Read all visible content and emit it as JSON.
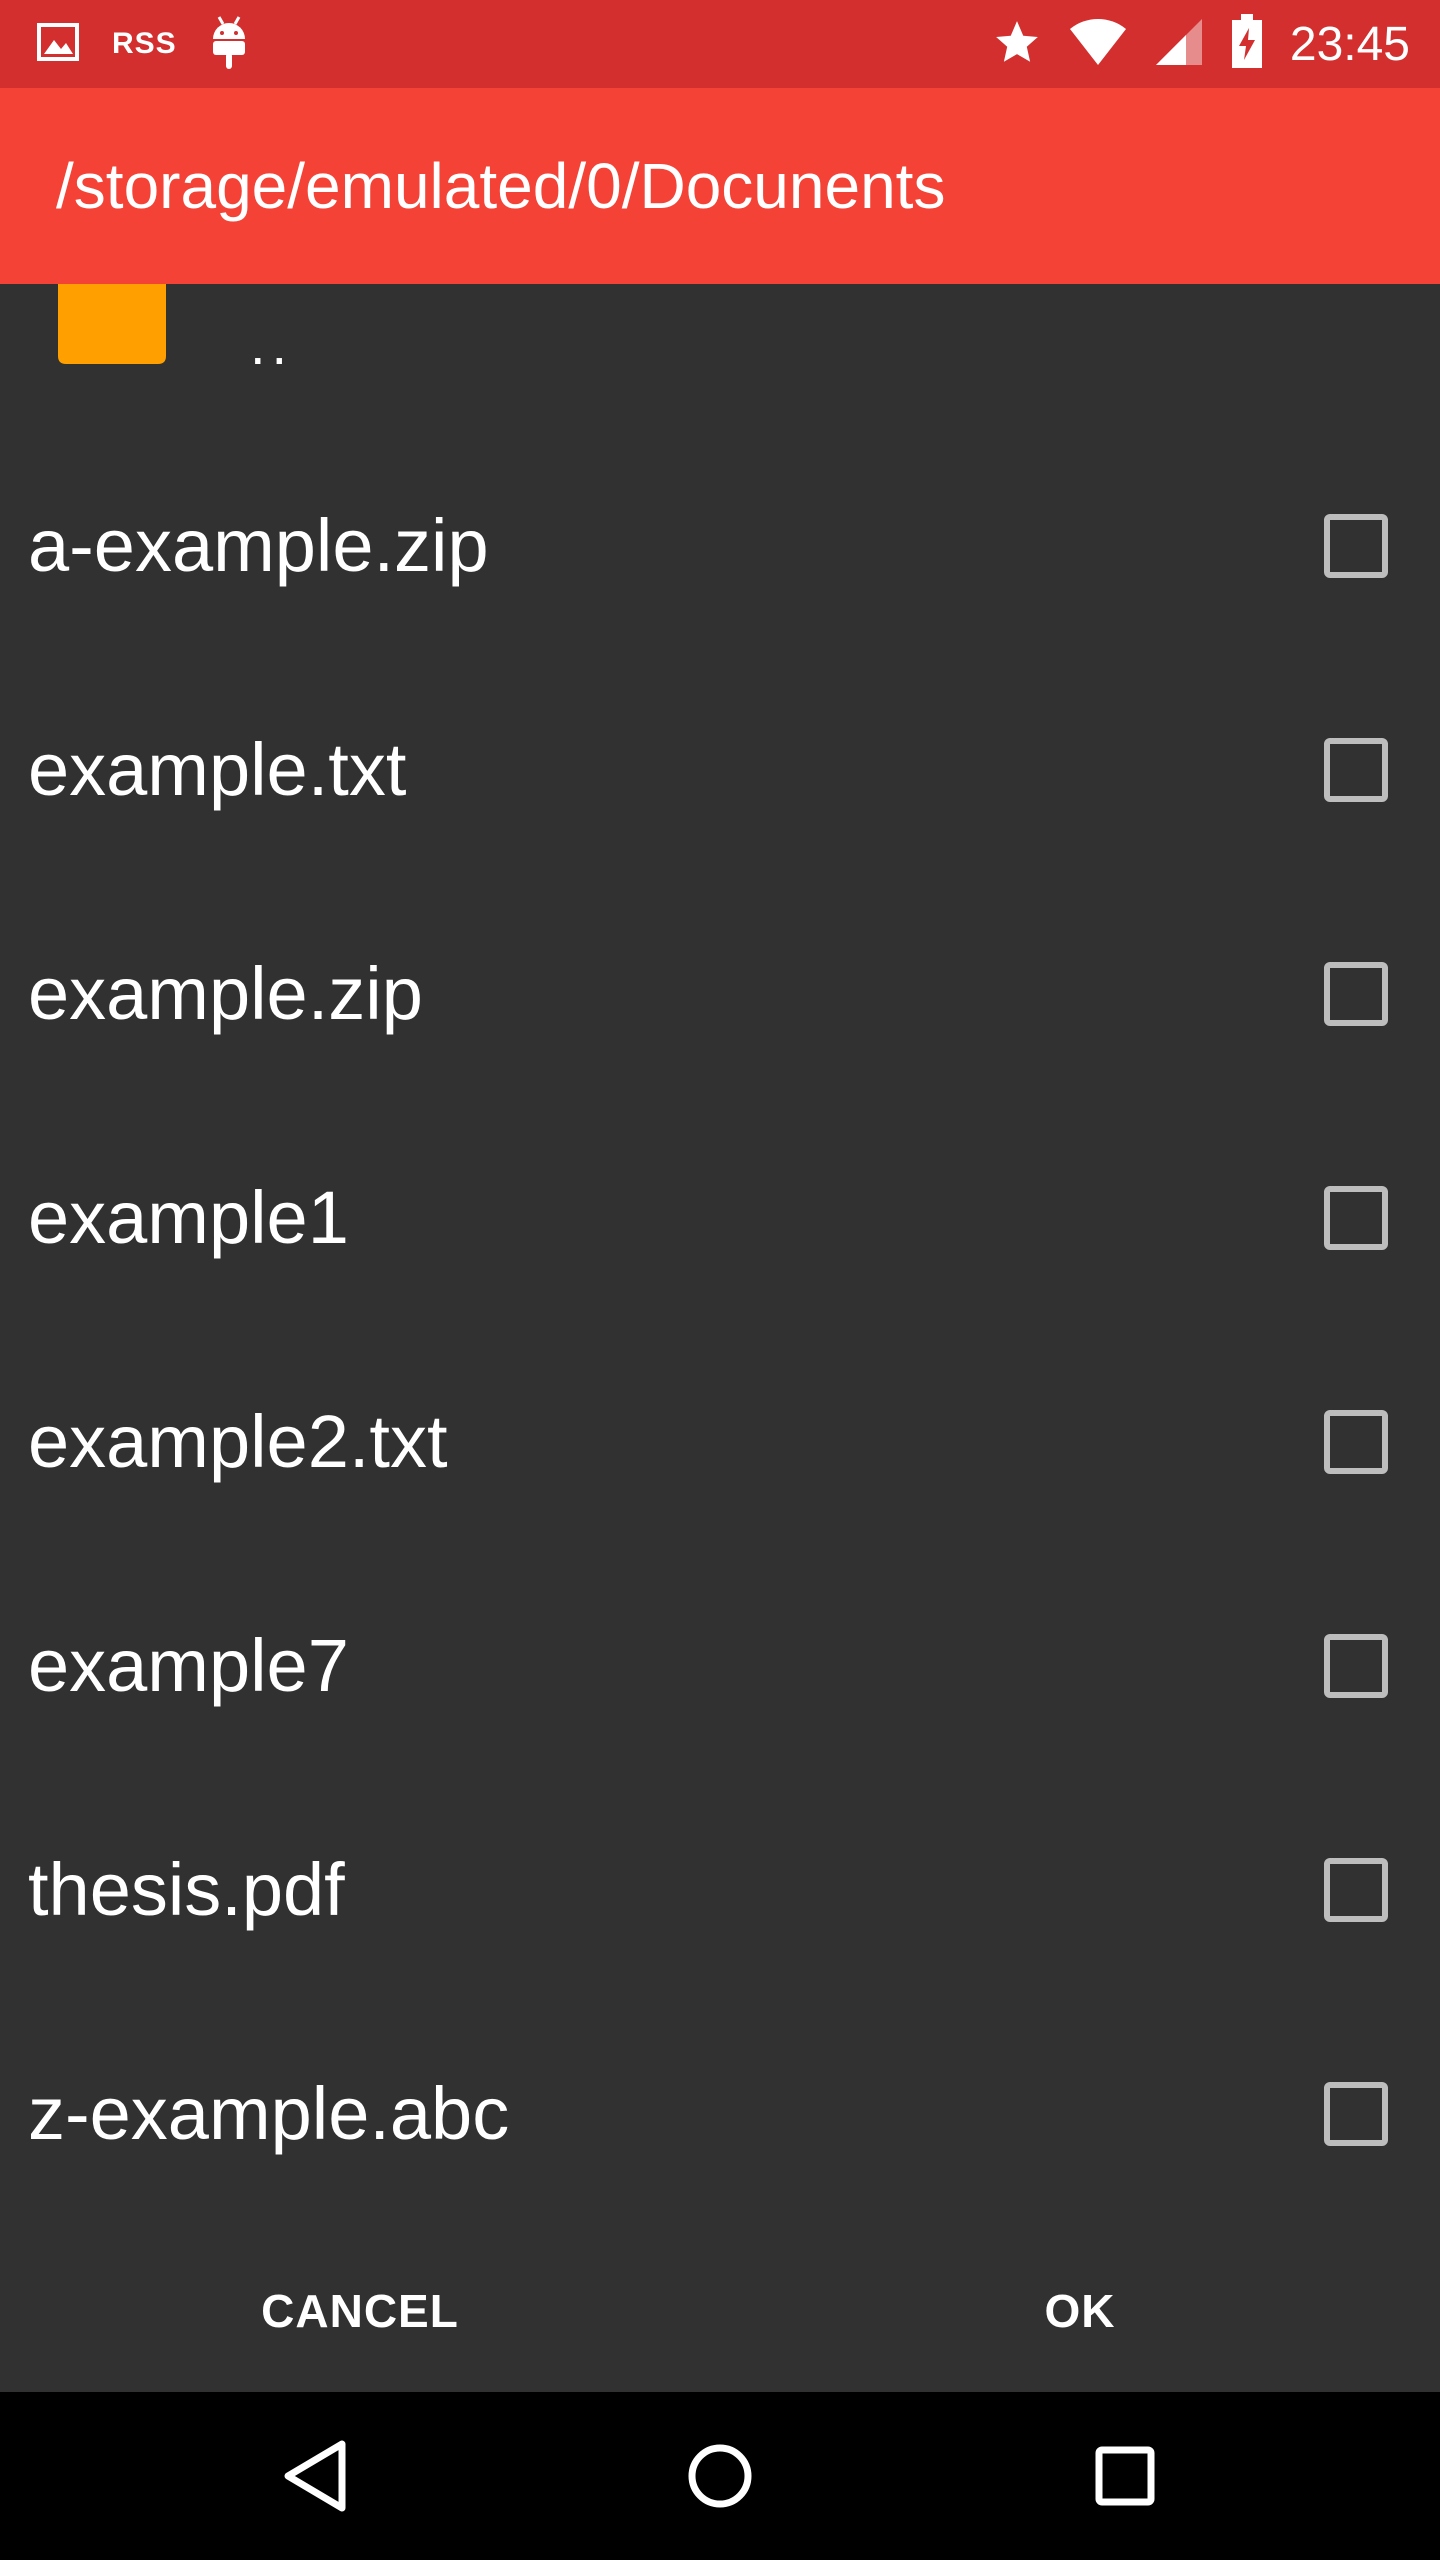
{
  "status_bar": {
    "left_icons": [
      "image-icon",
      "rss-text",
      "android-icon"
    ],
    "rss_label": "RSS",
    "right_icons": [
      "star-icon",
      "wifi-icon",
      "signal-icon",
      "battery-charging-icon"
    ],
    "time": "23:45",
    "color": "#D32F2F"
  },
  "toolbar": {
    "path": "/storage/emulated/0/Docunents",
    "color": "#F44336"
  },
  "list": {
    "parent_label": "..",
    "folder_color": "#FFA000",
    "files": [
      {
        "name": "a-example.zip",
        "checked": false
      },
      {
        "name": "example.txt",
        "checked": false
      },
      {
        "name": "example.zip",
        "checked": false
      },
      {
        "name": "example1",
        "checked": false
      },
      {
        "name": "example2.txt",
        "checked": false
      },
      {
        "name": "example7",
        "checked": false
      },
      {
        "name": "thesis.pdf",
        "checked": false
      },
      {
        "name": "z-example.abc",
        "checked": false
      }
    ]
  },
  "actions": {
    "cancel_label": "CANCEL",
    "ok_label": "OK"
  },
  "nav_bar": {
    "icons": [
      "back-icon",
      "home-icon",
      "recents-icon"
    ]
  }
}
